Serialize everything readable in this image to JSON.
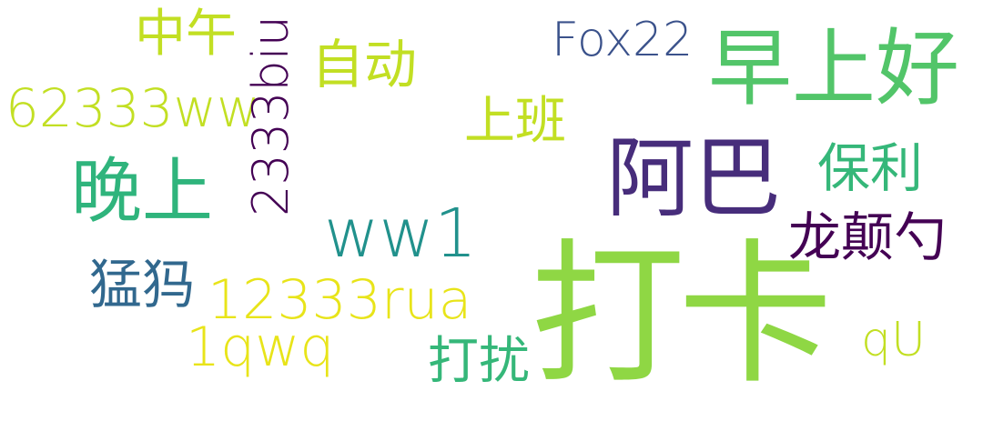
{
  "colors": {
    "background": "#ffffff",
    "light_green": "#8fd744",
    "green": "#52c569",
    "teal_green": "#35b779",
    "aqua": "#2fb47c",
    "teal": "#21918c",
    "dark_blue": "#3b528b",
    "slate_blue": "#31688e",
    "indigo": "#472d7b",
    "dark_purple": "#440154",
    "yellow": "#e8e419",
    "yellow_green": "#c2df23"
  },
  "words": [
    {
      "key": "daka",
      "text": "打卡"
    },
    {
      "key": "zaoshanghao",
      "text": "早上好"
    },
    {
      "key": "aba",
      "text": "阿巴"
    },
    {
      "key": "wanshang",
      "text": "晚上"
    },
    {
      "key": "ww1",
      "text": "ww1"
    },
    {
      "key": "fox22",
      "text": "Fox22"
    },
    {
      "key": "zhongwu",
      "text": "中午"
    },
    {
      "key": "zidong",
      "text": "自动"
    },
    {
      "key": "w62333ww",
      "text": "62333ww"
    },
    {
      "key": "shangban",
      "text": "上班"
    },
    {
      "key": "baoli",
      "text": "保利"
    },
    {
      "key": "longdianshao",
      "text": "龙颠勺"
    },
    {
      "key": "w2333biu",
      "text": "2333biu"
    },
    {
      "key": "mengma",
      "text": "猛犸"
    },
    {
      "key": "w12333rua",
      "text": "12333rua"
    },
    {
      "key": "w1qwq",
      "text": "1qwq"
    },
    {
      "key": "darao",
      "text": "打扰"
    },
    {
      "key": "qu",
      "text": "qU"
    }
  ]
}
